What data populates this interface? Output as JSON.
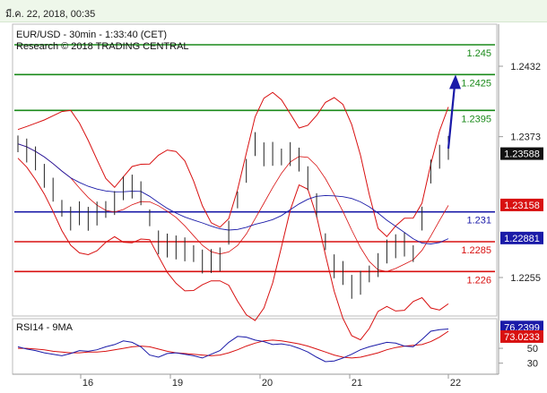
{
  "timestamp": "มี.ค. 22, 2018, 00:35",
  "chart_data": {
    "type": "line",
    "title": "EUR/USD - 30min - 1:33:40 (CET)",
    "subtitle": "Research © 2018 TRADING CENTRAL",
    "x_labels": [
      "16",
      "19",
      "20",
      "21",
      "22"
    ],
    "y_ticks": [
      "2432",
      "2373",
      "2255"
    ],
    "ylim": [
      1.2225,
      1.2465
    ],
    "levels": [
      {
        "value": 1.245,
        "label": "1.245",
        "color": "#1a8a1a"
      },
      {
        "value": 1.2425,
        "label": "1.2425",
        "color": "#1a8a1a"
      },
      {
        "value": 1.2395,
        "label": "1.2395",
        "color": "#1a8a1a"
      },
      {
        "value": 1.231,
        "label": "1.231",
        "color": "#1a1aa8"
      },
      {
        "value": 1.2285,
        "label": "1.2285",
        "color": "#d81010"
      },
      {
        "value": 1.226,
        "label": "1.226",
        "color": "#d81010"
      }
    ],
    "price_tags": [
      {
        "value": 1.23588,
        "label": "1.23588",
        "color": "#111111"
      },
      {
        "value": 1.23158,
        "label": "1.23158",
        "color": "#d81010"
      },
      {
        "value": 1.22881,
        "label": "1.22881",
        "color": "#1a1aa8"
      }
    ],
    "close_series": [
      1.2367,
      1.2362,
      1.2353,
      1.2342,
      1.2328,
      1.2313,
      1.2305,
      1.2307,
      1.2306,
      1.2308,
      1.2312,
      1.2318,
      1.2328,
      1.2333,
      1.2325,
      1.2305,
      1.2285,
      1.228,
      1.2282,
      1.2278,
      1.2275,
      1.2269,
      1.2267,
      1.2272,
      1.2292,
      1.232,
      1.2345,
      1.2365,
      1.236,
      1.2358,
      1.2356,
      1.2359,
      1.2352,
      1.234,
      1.2315,
      1.2285,
      1.2265,
      1.2257,
      1.2249,
      1.225,
      1.2258,
      1.2266,
      1.2275,
      1.2283,
      1.2282,
      1.2275,
      1.2305,
      1.2342,
      1.2358,
      1.2363
    ],
    "rsi": {
      "label": "RSI14 - 9MA",
      "ylim": [
        20,
        85
      ],
      "y_ticks": [
        "50",
        "30"
      ],
      "value_tags": [
        {
          "value": 76.2399,
          "label": "76.2399",
          "color": "#1a1aa8"
        },
        {
          "value": 73.0233,
          "label": "73.0233",
          "color": "#d81010"
        }
      ],
      "rsi_values": [
        52,
        49,
        47,
        44,
        42,
        40,
        43,
        47,
        46,
        48,
        52,
        55,
        60,
        58,
        52,
        41,
        38,
        43,
        44,
        42,
        40,
        37,
        42,
        47,
        58,
        66,
        65,
        61,
        59,
        55,
        56,
        54,
        50,
        45,
        38,
        32,
        33,
        37,
        42,
        48,
        52,
        55,
        58,
        57,
        53,
        52,
        62,
        73,
        75,
        76
      ],
      "ma_values": [
        50,
        50,
        49,
        48,
        46,
        45,
        44,
        44,
        45,
        45,
        46,
        48,
        50,
        52,
        53,
        52,
        49,
        46,
        44,
        43,
        42,
        41,
        40,
        41,
        44,
        48,
        53,
        57,
        60,
        61,
        60,
        58,
        56,
        53,
        49,
        45,
        41,
        38,
        37,
        38,
        41,
        44,
        48,
        51,
        53,
        54,
        55,
        59,
        65,
        73
      ]
    }
  }
}
